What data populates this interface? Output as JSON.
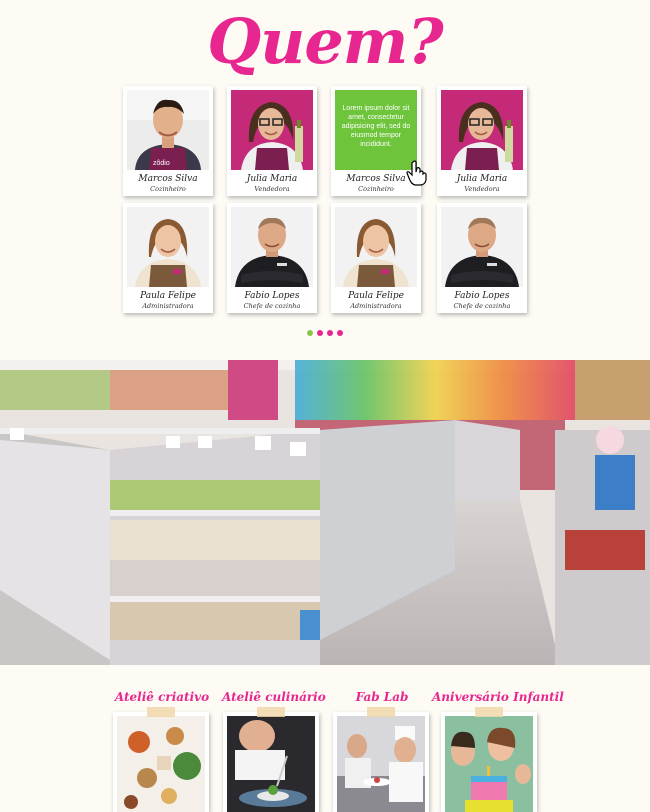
{
  "header": {
    "title": "Quem?"
  },
  "team": [
    {
      "name": "Marcos Silva",
      "role": "Cozinheiro",
      "photo": "man-apron",
      "bg": "#f0f0f0"
    },
    {
      "name": "Julia Maria",
      "role": "Vendedora",
      "photo": "woman-glasses",
      "bg": "#c42a78"
    },
    {
      "name": "Marcos Silva",
      "role": "Cozinheiro",
      "photo": "hover-text",
      "bg": "#6ec43a",
      "hover_text": "Lorem ipsum dolor sit amet, consectetur adipisicing elit, sed do eiusmod tempor incididunt."
    },
    {
      "name": "Julia Maria",
      "role": "Vendedora",
      "photo": "woman-glasses",
      "bg": "#c42a78"
    },
    {
      "name": "Paula Felipe",
      "role": "Administradora",
      "photo": "woman-apron",
      "bg": "#f2f2f2"
    },
    {
      "name": "Fabio Lopes",
      "role": "Chefe de cozinha",
      "photo": "chef",
      "bg": "#f2f2f2"
    },
    {
      "name": "Paula Felipe",
      "role": "Administradora",
      "photo": "woman-apron",
      "bg": "#f2f2f2"
    },
    {
      "name": "Fabio Lopes",
      "role": "Chefe de cozinha",
      "photo": "chef",
      "bg": "#f2f2f2"
    }
  ],
  "pagination": {
    "dots": [
      "#8bc34a",
      "#e8268f",
      "#e8268f",
      "#e8268f"
    ]
  },
  "store_photo": {
    "description_icon": "store-aisle-photo"
  },
  "workshops": [
    {
      "title": "Ateliê criativo",
      "photo": "craft-photo"
    },
    {
      "title": "Ateliê culinário",
      "photo": "plating-photo"
    },
    {
      "title": "Fab Lab",
      "photo": "kitchen-photo"
    },
    {
      "title": "Aniversário Infantil",
      "photo": "party-photo"
    }
  ],
  "colors": {
    "accent": "#e8268f",
    "green": "#6ec43a",
    "background": "#fdfbf4"
  }
}
